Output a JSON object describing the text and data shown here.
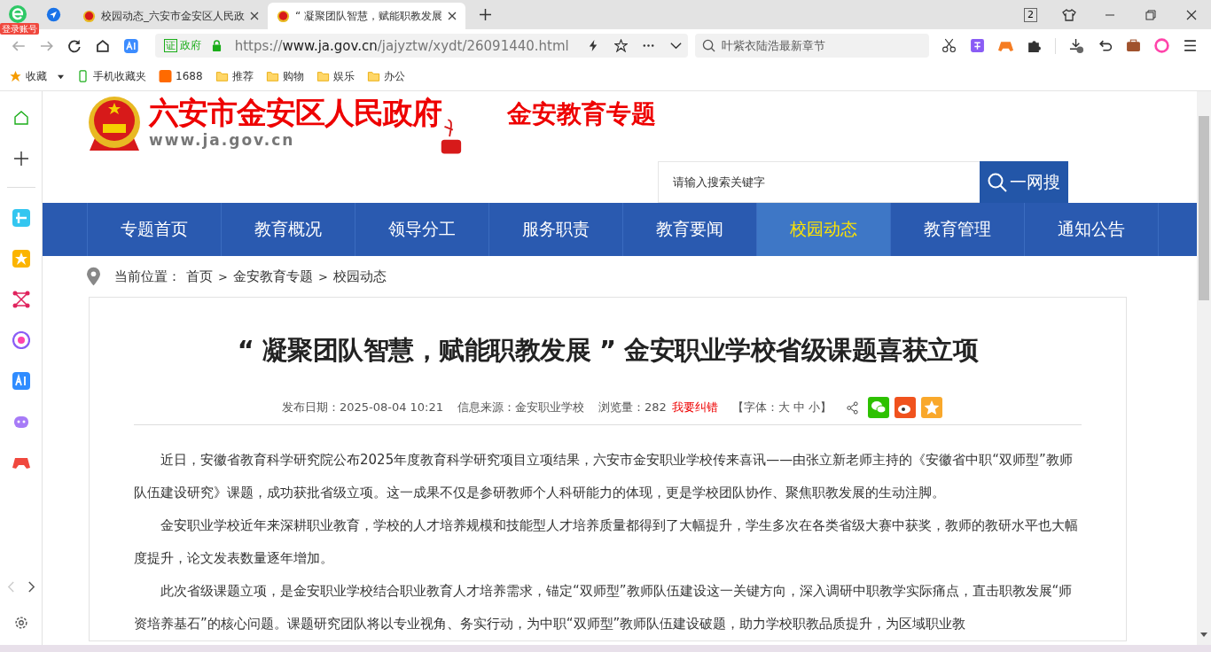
{
  "browser": {
    "login_badge": "登录账号",
    "tabs": [
      {
        "title": "校园动态_六安市金安区人民政",
        "selected": false
      },
      {
        "title": "“ 凝聚团队智慧，赋能职教发展",
        "selected": true
      }
    ],
    "tab_count": "2",
    "address": {
      "security_mark": "证",
      "security_label": "政府",
      "url_scheme": "https://",
      "url_host": "www.ja.gov.cn",
      "url_path": "/jajyztw/xydt/26091440.html"
    },
    "search": {
      "placeholder": "叶紫衣陆浩最新章节"
    },
    "bookmarks": [
      {
        "label": "收藏",
        "kind": "star"
      },
      {
        "label": "手机收藏夹",
        "kind": "phone"
      },
      {
        "label": "1688",
        "kind": "app"
      },
      {
        "label": "推荐",
        "kind": "folder"
      },
      {
        "label": "购物",
        "kind": "folder"
      },
      {
        "label": "娱乐",
        "kind": "folder"
      },
      {
        "label": "办公",
        "kind": "folder"
      }
    ]
  },
  "page": {
    "site_title": "六安市金安区人民政府",
    "site_url": "www.ja.gov.cn",
    "topic_title": "金安教育专题",
    "search": {
      "placeholder": "请输入搜索关键字",
      "button": "一网搜"
    },
    "nav": [
      {
        "label": "专题首页",
        "selected": false
      },
      {
        "label": "教育概况",
        "selected": false
      },
      {
        "label": "领导分工",
        "selected": false
      },
      {
        "label": "服务职责",
        "selected": false
      },
      {
        "label": "教育要闻",
        "selected": false
      },
      {
        "label": "校园动态",
        "selected": true
      },
      {
        "label": "教育管理",
        "selected": false
      },
      {
        "label": "通知公告",
        "selected": false
      }
    ],
    "breadcrumb": {
      "label": "当前位置：",
      "items": [
        "首页",
        "金安教育专题",
        "校园动态"
      ],
      "separator": ">"
    },
    "article": {
      "title": "“ 凝聚团队智慧，赋能职教发展 ” 金安职业学校省级课题喜获立项",
      "meta": {
        "date": "发布日期：2025-08-04 10:21",
        "source": "信息来源：金安职业学校",
        "views": "浏览量：282",
        "report_link": "我要纠错",
        "font_size": "【字体：大 中 小】"
      },
      "paragraphs": [
        "近日，安徽省教育科学研究院公布2025年度教育科学研究项目立项结果，六安市金安职业学校传来喜讯——由张立新老师主持的《安徽省中职“双师型”教师队伍建设研究》课题，成功获批省级立项。这一成果不仅是参研教师个人科研能力的体现，更是学校团队协作、聚焦职教发展的生动注脚。",
        "金安职业学校近年来深耕职业教育，学校的人才培养规模和技能型人才培养质量都得到了大幅提升，学生多次在各类省级大赛中获奖，教师的教研水平也大幅度提升，论文发表数量逐年增加。",
        "此次省级课题立项，是金安职业学校结合职业教育人才培养需求，锚定“双师型”教师队伍建设这一关键方向，深入调研中职教学实际痛点，直击职教发展“师资培养基石”的核心问题。课题研究团队将以专业视角、务实行动，为中职“双师型”教师队伍建设破题，助力学校职教品质提升，为区域职业教"
      ]
    }
  }
}
